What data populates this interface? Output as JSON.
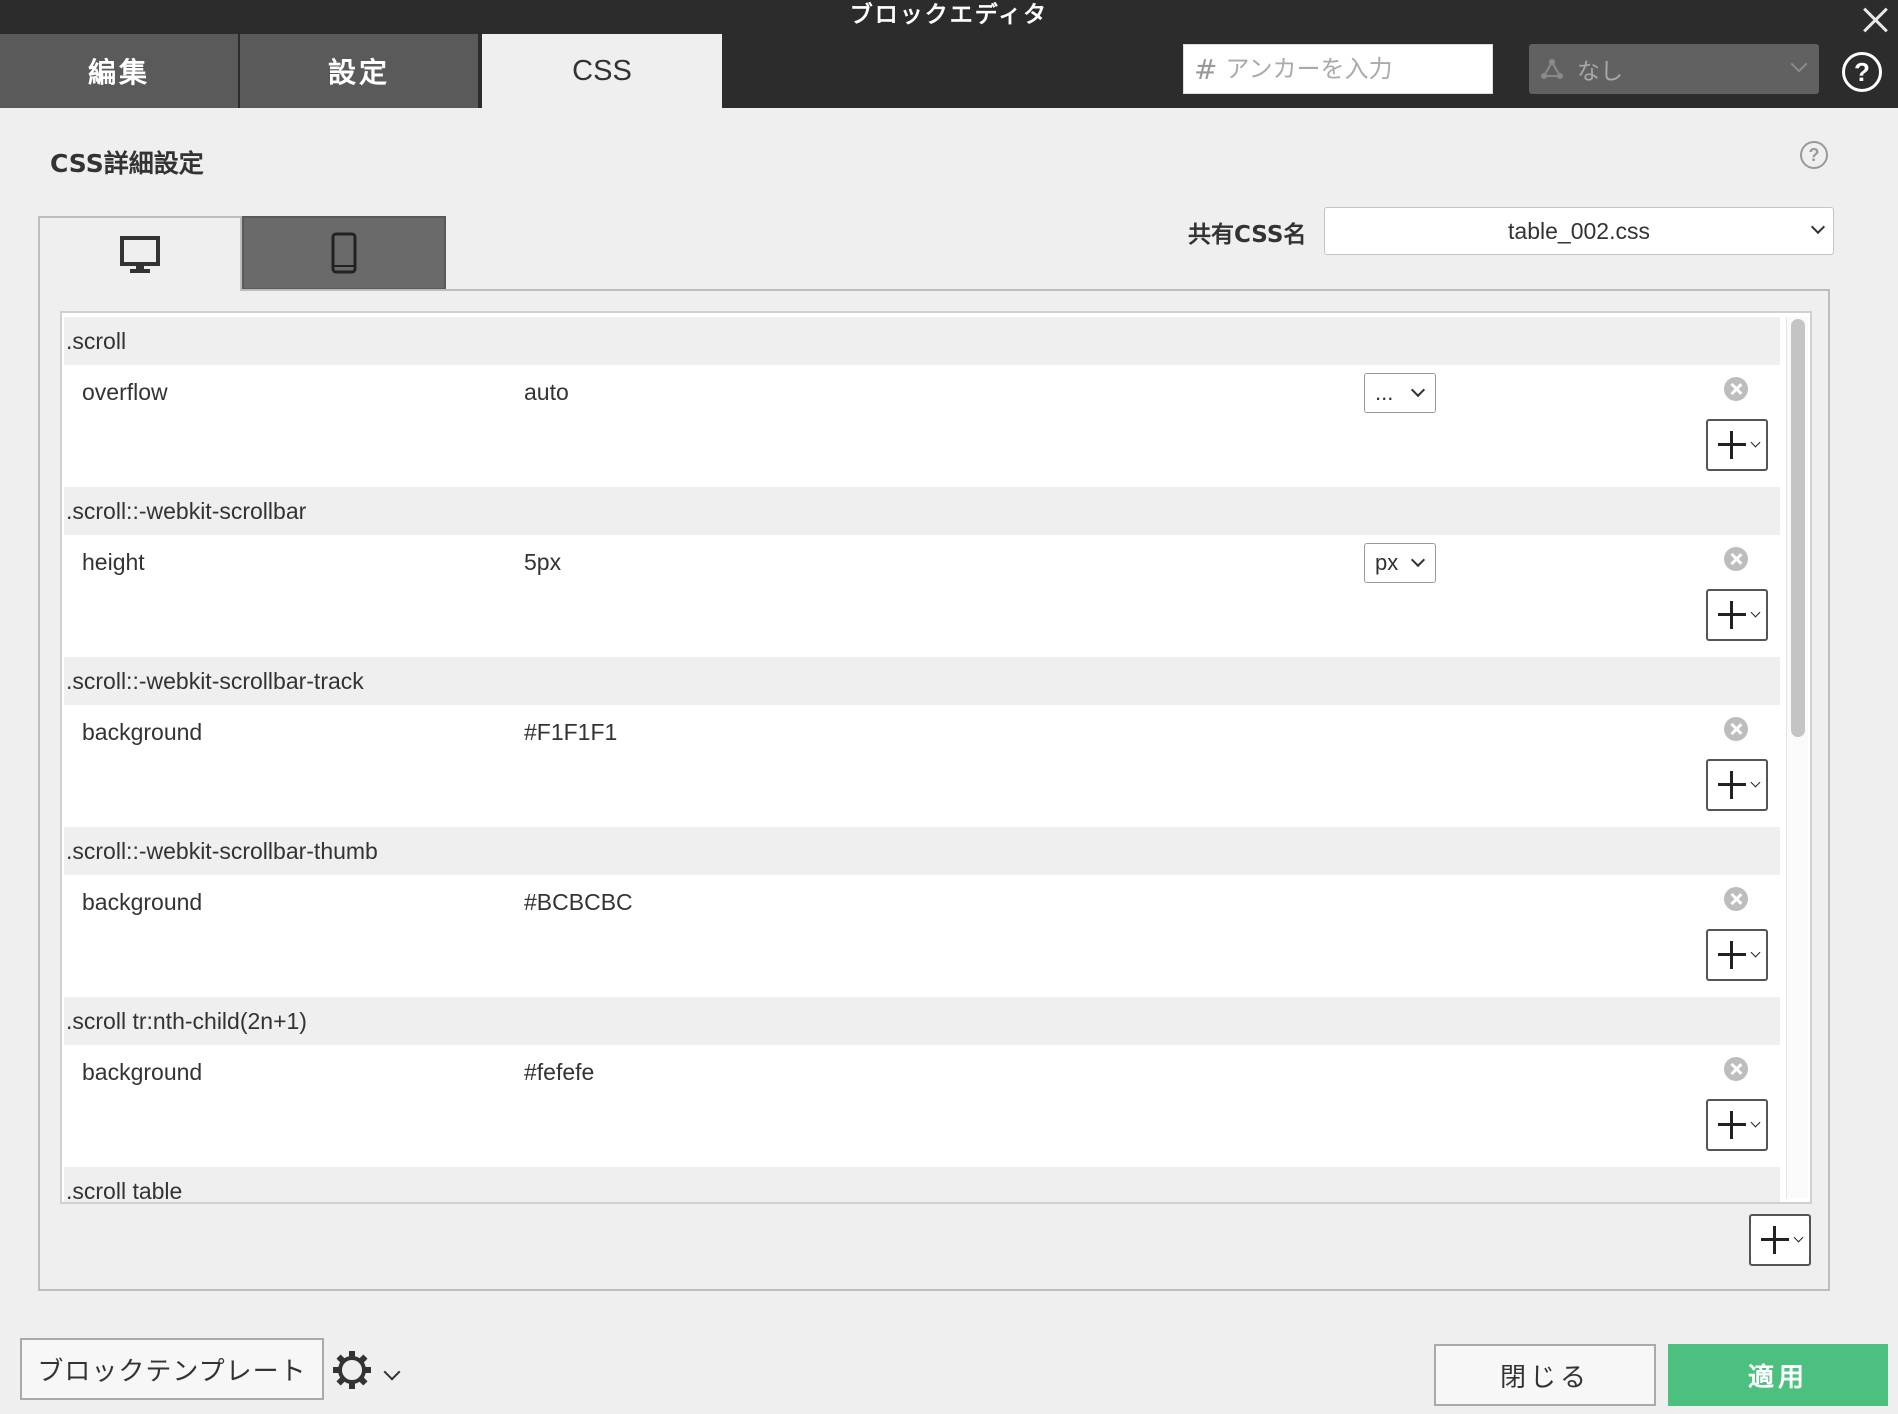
{
  "window": {
    "title": "ブロックエディタ"
  },
  "tabs": [
    {
      "label": "編集"
    },
    {
      "label": "設定"
    },
    {
      "label": "CSS",
      "active": true
    }
  ],
  "anchor": {
    "placeholder": "アンカーを入力",
    "value": ""
  },
  "role_select": {
    "value": "なし"
  },
  "section": {
    "title": "CSS詳細設定"
  },
  "device_tabs": [
    {
      "name": "desktop",
      "active": true
    },
    {
      "name": "smartphone",
      "active": false
    }
  ],
  "shared_css": {
    "label": "共有CSS名",
    "value": "table_002.css"
  },
  "rules": [
    {
      "selector": ".scroll",
      "props": [
        {
          "name": "overflow",
          "value": "auto",
          "unit": "..."
        }
      ]
    },
    {
      "selector": ".scroll::-webkit-scrollbar",
      "props": [
        {
          "name": "height",
          "value": "5px",
          "unit": "px"
        }
      ]
    },
    {
      "selector": ".scroll::-webkit-scrollbar-track",
      "props": [
        {
          "name": "background",
          "value": "#F1F1F1",
          "unit": null
        }
      ]
    },
    {
      "selector": ".scroll::-webkit-scrollbar-thumb",
      "props": [
        {
          "name": "background",
          "value": "#BCBCBC",
          "unit": null
        }
      ]
    },
    {
      "selector": ".scroll tr:nth-child(2n+1)",
      "props": [
        {
          "name": "background",
          "value": "#fefefe",
          "unit": null
        }
      ]
    },
    {
      "selector": ".scroll table",
      "props": []
    }
  ],
  "footer": {
    "template_button": "ブロックテンプレート",
    "close_button": "閉じる",
    "apply_button": "適用"
  },
  "colors": {
    "header": "#2c2c2c",
    "tab": "#5a5a5a",
    "apply": "#4cc07f"
  }
}
